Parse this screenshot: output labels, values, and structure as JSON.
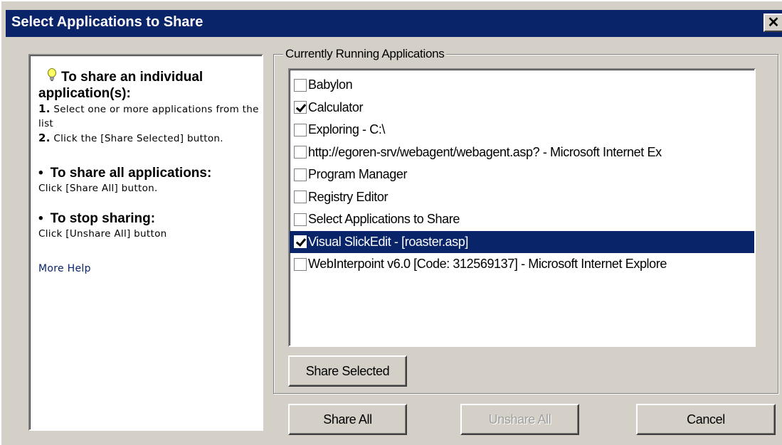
{
  "window": {
    "title": "Select Applications to Share",
    "close_label": "✕"
  },
  "help": {
    "heading_individual": "To share an individual application(s):",
    "step1_num": "1.",
    "step1_text": " Select one or more applications from the list",
    "step2_num": "2.",
    "step2_text": " Click the [Share Selected] button.",
    "heading_all": "To share all applications:",
    "all_text": "Click [Share All] button.",
    "heading_stop": "To stop sharing:",
    "stop_text": "Click [Unshare All] button",
    "more_help": "More Help",
    "bullet": "•"
  },
  "applications": {
    "group_label": "Currently Running Applications",
    "items": [
      {
        "label": "Babylon",
        "checked": false,
        "selected": false
      },
      {
        "label": "Calculator",
        "checked": true,
        "selected": false
      },
      {
        "label": "Exploring - C:\\",
        "checked": false,
        "selected": false
      },
      {
        "label": "http://egoren-srv/webagent/webagent.asp? - Microsoft Internet Ex",
        "checked": false,
        "selected": false
      },
      {
        "label": "Program Manager",
        "checked": false,
        "selected": false
      },
      {
        "label": "Registry Editor",
        "checked": false,
        "selected": false
      },
      {
        "label": "Select Applications to Share",
        "checked": false,
        "selected": false
      },
      {
        "label": "Visual SlickEdit - [roaster.asp]",
        "checked": true,
        "selected": true
      },
      {
        "label": "WebInterpoint v6.0 [Code: 312569137] - Microsoft Internet Explore",
        "checked": false,
        "selected": false
      }
    ]
  },
  "buttons": {
    "share_selected": "Share Selected",
    "share_all": "Share All",
    "unshare_all": "Unshare All",
    "cancel": "Cancel"
  },
  "colors": {
    "title_bar": "#0a246a",
    "selection": "#0a246a",
    "face": "#d4d0c8"
  }
}
